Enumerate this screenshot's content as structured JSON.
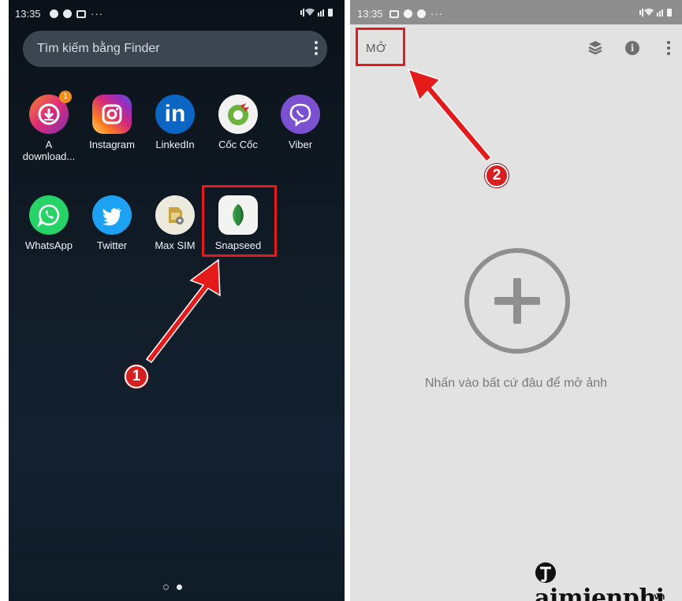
{
  "left_phone": {
    "status": {
      "time": "13:35",
      "more": "···"
    },
    "search_placeholder": "Tìm kiếm bằng Finder",
    "apps_row1": [
      {
        "label": "A download...",
        "color": "#c9306f",
        "icon": "download-icon",
        "badge": "1"
      },
      {
        "label": "Instagram",
        "color": "#d62d7b",
        "icon": "instagram-icon"
      },
      {
        "label": "LinkedIn",
        "color": "#0a66c2",
        "icon": "linkedin-icon"
      },
      {
        "label": "Cốc Cốc",
        "color": "#7bbf3a",
        "icon": "coccoc-icon"
      },
      {
        "label": "Viber",
        "color": "#7b51d1",
        "icon": "viber-icon"
      }
    ],
    "apps_row2": [
      {
        "label": "WhatsApp",
        "color": "#25d366",
        "icon": "whatsapp-icon"
      },
      {
        "label": "Twitter",
        "color": "#1da1f2",
        "icon": "twitter-icon"
      },
      {
        "label": "Max SIM",
        "color": "#e9e6dc",
        "icon": "sim-card-icon"
      },
      {
        "label": "Snapseed",
        "color": "#f3f4f2",
        "icon": "snapseed-leaf-icon"
      }
    ],
    "app_label_download_line1": "A",
    "app_label_download_line2": "download...",
    "pager": {
      "pages": 2,
      "current": 2
    }
  },
  "right_phone": {
    "status": {
      "time": "13:35",
      "more": "···"
    },
    "open_label": "MỞ",
    "info_symbol": "i",
    "hint": "Nhấn vào bất cứ đâu để mở ảnh"
  },
  "annotations": {
    "step1": "1",
    "step2": "2",
    "highlight_color": "#e51b1b"
  },
  "watermark": {
    "main": "aimienphi",
    "tld": ".vn"
  }
}
